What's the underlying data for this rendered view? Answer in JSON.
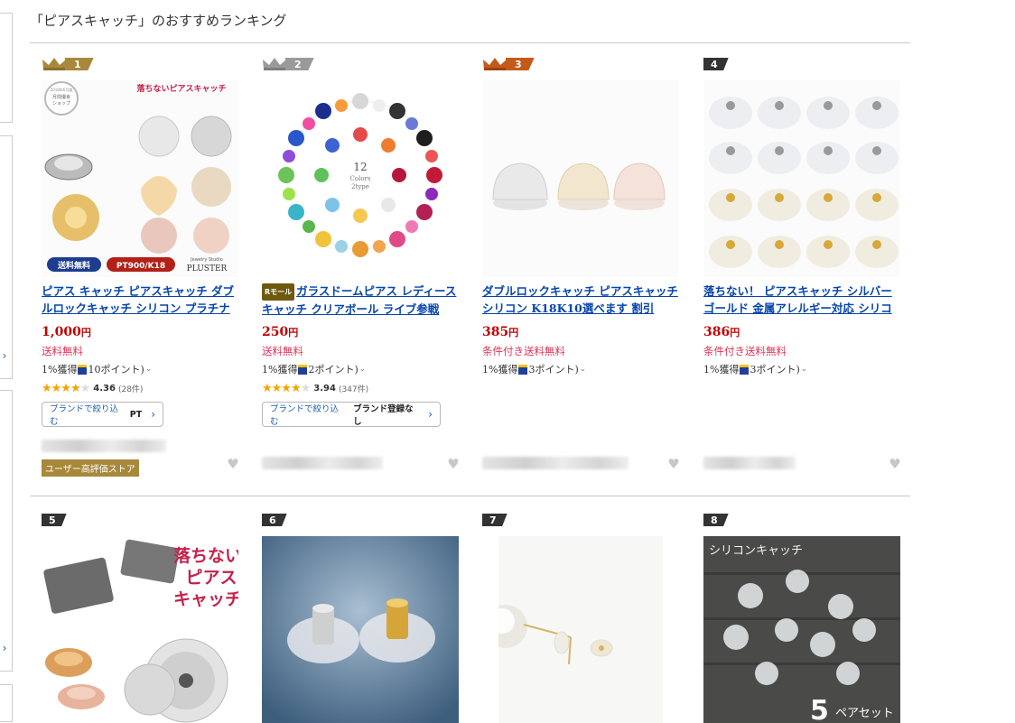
{
  "heading": "「ピアスキャッチ」のおすすめランキング",
  "colors": {
    "gold": "#a8893b",
    "silver": "#9a9a9a",
    "bronze": "#c35a1a",
    "dark": "#333333",
    "price": "#bf0000",
    "link": "#0645ad"
  },
  "ranking": [
    {
      "rank": "1",
      "crown": "gold-crown-icon",
      "title": "ピアス キャッチ ピアスキャッチ ダブルロックキャッチ シリコン プラチナ PT900",
      "price": "1,000",
      "yen": "円",
      "shipping": "送料無料",
      "points_prefix": "1%獲得",
      "points": "10ポイント)",
      "rating": "4.36",
      "reviews": "(28件)",
      "brand_label": "ブランドで絞り込む",
      "brand_value": "PT",
      "high_badge": "ユーザー高評価ストア",
      "img_texts": {
        "seal": "2018年6月度 月間優良 ショップ",
        "headline": "落ちないピアスキャッチ",
        "tag1": "送料無料",
        "tag2": "PT900/K18",
        "studio": "Jewelry Studio",
        "brand": "PLUSTER"
      }
    },
    {
      "rank": "2",
      "crown": "silver-crown-icon",
      "mall_badge": "Rモール",
      "title": "ガラスドームピアス レディース キャッチ クリアボール ライブ参戦",
      "price": "250",
      "yen": "円",
      "shipping": "送料無料",
      "points_prefix": "1%獲得",
      "points": "2ポイント)",
      "rating": "3.94",
      "reviews": "(347件)",
      "brand_label": "ブランドで絞り込む",
      "brand_value": "ブランド登録なし",
      "img_texts": {
        "num": "12",
        "line1": "Colors",
        "line2": "2type"
      }
    },
    {
      "rank": "3",
      "crown": "bronze-crown-icon",
      "title": "ダブルロックキャッチ ピアスキャッチ シリコン K18K10選べます 割引",
      "price": "385",
      "yen": "円",
      "shipping": "条件付き送料無料",
      "points_prefix": "1%獲得",
      "points": "3ポイント)"
    },
    {
      "rank": "4",
      "title": "落ちない！ ピアスキャッチ シルバー ゴールド 金属アレルギー対応 シリコン",
      "price": "386",
      "yen": "円",
      "shipping": "条件付き送料無料",
      "points_prefix": "1%獲得",
      "points": "3ポイント)"
    },
    {
      "rank": "5",
      "img_texts": {
        "headline1": "落ちない",
        "headline2": "ピアス",
        "headline3": "キャッチ"
      }
    },
    {
      "rank": "6"
    },
    {
      "rank": "7"
    },
    {
      "rank": "8",
      "img_texts": {
        "caption": "シリコンキャッチ",
        "big": "5",
        "suffix": "ペアセット"
      }
    }
  ]
}
